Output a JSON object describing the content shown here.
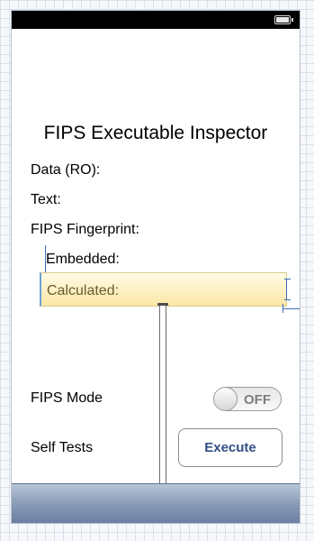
{
  "view": {
    "title": "FIPS Executable Inspector",
    "labels": {
      "data_ro": "Data (RO):",
      "text": "Text:",
      "fips_fingerprint": "FIPS Fingerprint:",
      "embedded": "Embedded:",
      "calculated": "Calculated:",
      "fips_mode": "FIPS Mode",
      "self_tests": "Self Tests"
    },
    "fips_mode_switch": {
      "state_label": "OFF",
      "on": false
    },
    "execute_button": {
      "label": "Execute"
    }
  },
  "icons": {
    "battery": "battery-icon"
  },
  "colors": {
    "status_bar": "#000000",
    "toolbar": "#8a9bb7",
    "highlight": "#fbe7a6",
    "button_text": "#324f85",
    "guide": "#3c6db7"
  }
}
